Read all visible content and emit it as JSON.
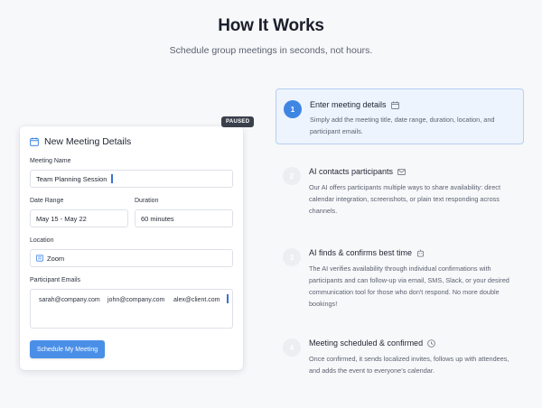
{
  "hero": {
    "title": "How It Works",
    "subtitle": "Schedule group meetings in seconds, not hours."
  },
  "card": {
    "badge": "PAUSED",
    "title": "New Meeting Details",
    "meeting_name_label": "Meeting Name",
    "meeting_name_value": "Team Planning Session",
    "date_range_label": "Date Range",
    "date_range_value": "May 15 - May 22",
    "duration_label": "Duration",
    "duration_value": "60 minutes",
    "location_label": "Location",
    "location_value": "Zoom",
    "emails_label": "Participant Emails",
    "emails": [
      "sarah@company.com",
      "john@company.com",
      "alex@client.com"
    ],
    "submit_label": "Schedule My Meeting"
  },
  "steps": [
    {
      "number": "1",
      "title": "Enter meeting details",
      "icon": "calendar-icon",
      "description": "Simply add the meeting title, date range, duration, location, and participant emails.",
      "active": true
    },
    {
      "number": "2",
      "title": "AI contacts participants",
      "icon": "mail-icon",
      "description": "Our AI offers participants multiple ways to share availability: direct calendar integration, screenshots, or plain text responding across channels.",
      "active": false
    },
    {
      "number": "3",
      "title": "AI finds & confirms best time",
      "icon": "robot-icon",
      "description": "The AI verifies availability through individual confirmations with participants and can follow-up via email, SMS, Slack, or your desired communication tool for those who don't respond. No more double bookings!",
      "active": false
    },
    {
      "number": "4",
      "title": "Meeting scheduled & confirmed",
      "icon": "clock-icon",
      "description": "Once confirmed, it sends localized invites, follows up with attendees, and adds the event to everyone's calendar.",
      "active": false
    }
  ],
  "colors": {
    "accent": "#3f86e3",
    "button": "#4a8fe7",
    "active_step_bg": "#eef4fd",
    "badge_bg": "#3a404b"
  }
}
